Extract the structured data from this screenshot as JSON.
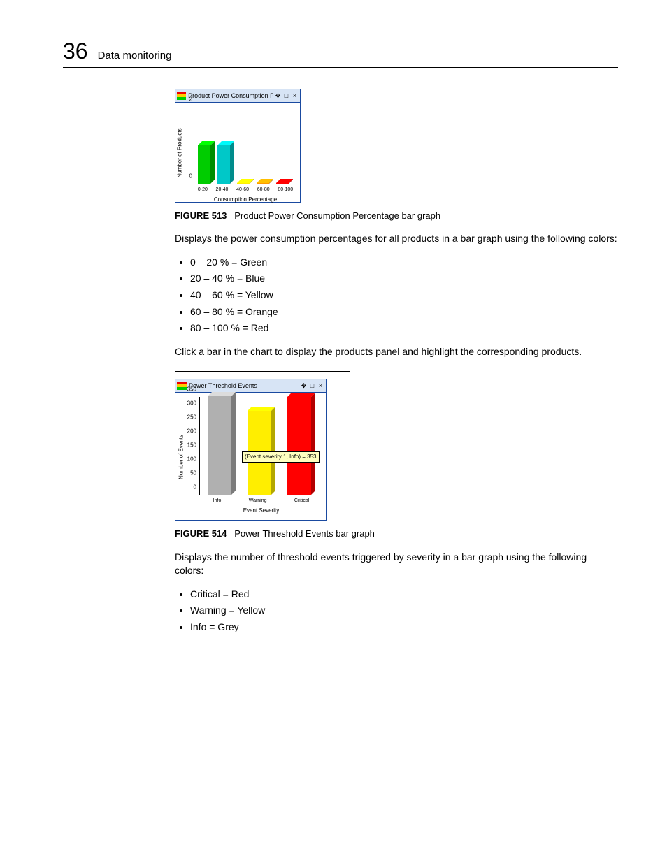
{
  "header": {
    "chapter_number": "36",
    "chapter_title": "Data monitoring"
  },
  "fig1": {
    "caption_label": "FIGURE 513",
    "caption_text": "Product Power Consumption Percentage bar graph",
    "widget_title": "Product Power Consumption P...",
    "xlabel": "Consumption Percentage",
    "ylabel": "Number of Products"
  },
  "para1": "Displays the power consumption percentages for all products in a bar graph using the following colors:",
  "list1": [
    "0 –  20 % = Green",
    "20 – 40 % = Blue",
    "40 – 60 % = Yellow",
    "60 – 80 % = Orange",
    "80 – 100 % = Red"
  ],
  "para2": "Click a bar in the chart to display the products panel and highlight the corresponding products.",
  "fig2": {
    "caption_label": "FIGURE 514",
    "caption_text": "Power Threshold Events bar graph",
    "widget_title": "Power Threshold Events",
    "xlabel": "Event Severity",
    "ylabel": "Number of Events",
    "tooltip": "(Event severity 1, Info) = 353"
  },
  "para3": "Displays the number of threshold events triggered by severity in a bar graph using the following colors:",
  "list2": [
    "Critical = Red",
    "Warning = Yellow",
    "Info = Grey"
  ],
  "chart_data": [
    {
      "type": "bar",
      "title": "Product Power Consumption Percentage",
      "xlabel": "Consumption Percentage",
      "ylabel": "Number of Products",
      "categories": [
        "0-20",
        "20-40",
        "40-60",
        "60-80",
        "80-100"
      ],
      "values": [
        1,
        1,
        0,
        0,
        0
      ],
      "colors": [
        "#00cc00",
        "#00c8c8",
        "#ffee00",
        "#ff9900",
        "#ff0000"
      ],
      "ylim": [
        0,
        2
      ],
      "yticks": [
        0,
        2
      ]
    },
    {
      "type": "bar",
      "title": "Power Threshold Events",
      "xlabel": "Event Severity",
      "ylabel": "Number of Events",
      "categories": [
        "Info",
        "Warning",
        "Critical"
      ],
      "values": [
        353,
        300,
        350
      ],
      "colors": [
        "#b0b0b0",
        "#ffee00",
        "#ff0000"
      ],
      "ylim": [
        0,
        350
      ],
      "yticks": [
        0,
        50,
        100,
        150,
        200,
        250,
        300,
        350
      ],
      "annotations": [
        "(Event severity 1, Info) = 353"
      ]
    }
  ]
}
